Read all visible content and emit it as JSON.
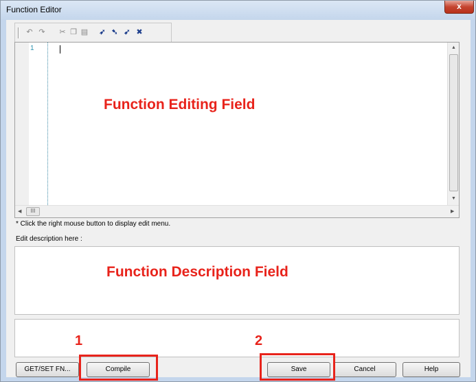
{
  "window": {
    "title": "Function Editor",
    "close_label": "x"
  },
  "toolbar": {
    "icons": [
      "undo-icon",
      "redo-icon",
      "cut-icon",
      "copy-icon",
      "paste-icon",
      "bookmark-toggle-icon",
      "bookmark-next-icon",
      "bookmark-prev-icon",
      "bookmark-clear-icon"
    ]
  },
  "editor": {
    "line_number": "1",
    "overlay_label": "Function Editing Field",
    "hscroll_thumb": "III"
  },
  "hint": "* Click the right mouse button to display edit menu.",
  "description": {
    "label": "Edit description here :",
    "overlay_label": "Function Description Field"
  },
  "buttons": {
    "getset": "GET/SET FN...",
    "compile": "Compile",
    "save": "Save",
    "cancel": "Cancel",
    "help": "Help"
  },
  "annotations": {
    "marker1": "1",
    "marker2": "2",
    "color": "#e8231b"
  }
}
